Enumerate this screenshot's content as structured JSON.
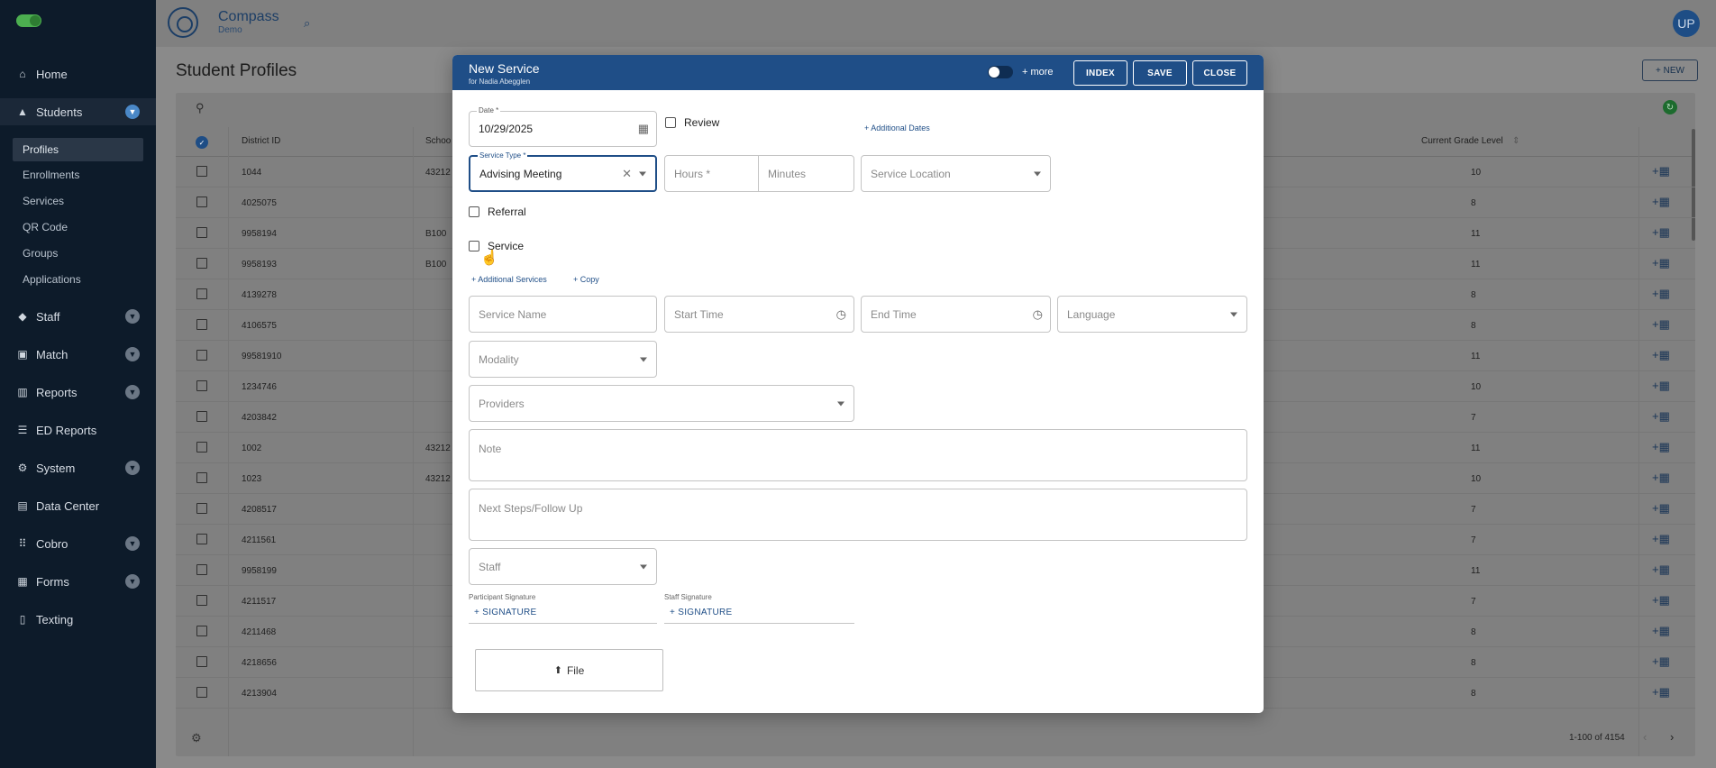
{
  "sidebar": {
    "items": [
      {
        "label": "Home",
        "icon": "home-icon"
      },
      {
        "label": "Students",
        "icon": "students-icon",
        "expanded": true
      },
      {
        "label": "Staff",
        "icon": "staff-icon"
      },
      {
        "label": "Match",
        "icon": "match-icon"
      },
      {
        "label": "Reports",
        "icon": "reports-icon"
      },
      {
        "label": "ED Reports",
        "icon": "ed-reports-icon"
      },
      {
        "label": "System",
        "icon": "gear-icon"
      },
      {
        "label": "Data Center",
        "icon": "data-center-icon"
      },
      {
        "label": "Cobro",
        "icon": "grid-icon"
      },
      {
        "label": "Forms",
        "icon": "forms-icon"
      },
      {
        "label": "Texting",
        "icon": "texting-icon"
      }
    ],
    "students_sub": [
      "Profiles",
      "Enrollments",
      "Services",
      "QR Code",
      "Groups",
      "Applications"
    ]
  },
  "header": {
    "brand": "Compass",
    "brand_sub": "Demo",
    "avatar": "UP"
  },
  "page": {
    "title": "Student Profiles",
    "new_button": "+ NEW"
  },
  "table": {
    "columns": [
      "District ID",
      "Schoo",
      "Current Grade Level"
    ],
    "rows": [
      {
        "id": "1044",
        "school": "43212",
        "grade": "10"
      },
      {
        "id": "4025075",
        "school": "",
        "grade": "8"
      },
      {
        "id": "9958194",
        "school": "B100",
        "grade": "11"
      },
      {
        "id": "9958193",
        "school": "B100",
        "grade": "11"
      },
      {
        "id": "4139278",
        "school": "",
        "grade": "8"
      },
      {
        "id": "4106575",
        "school": "",
        "grade": "8"
      },
      {
        "id": "99581910",
        "school": "",
        "grade": "11"
      },
      {
        "id": "1234746",
        "school": "",
        "grade": "10"
      },
      {
        "id": "4203842",
        "school": "",
        "grade": "7"
      },
      {
        "id": "1002",
        "school": "43212",
        "grade": "11"
      },
      {
        "id": "1023",
        "school": "43212",
        "grade": "10"
      },
      {
        "id": "4208517",
        "school": "",
        "grade": "7"
      },
      {
        "id": "4211561",
        "school": "",
        "grade": "7"
      },
      {
        "id": "9958199",
        "school": "",
        "grade": "11"
      },
      {
        "id": "4211517",
        "school": "",
        "grade": "7"
      },
      {
        "id": "4211468",
        "school": "",
        "grade": "8"
      },
      {
        "id": "4218656",
        "school": "",
        "grade": "8"
      },
      {
        "id": "4213904",
        "school": "",
        "grade": "8"
      }
    ],
    "pagination": "1-100 of 4154"
  },
  "modal": {
    "title": "New Service",
    "subtitle": "for Nadia Abegglen",
    "more_label": "+ more",
    "index_btn": "INDEX",
    "save_btn": "SAVE",
    "close_btn": "CLOSE",
    "date_label": "Date *",
    "date_value": "10/29/2025",
    "review_label": "Review",
    "additional_dates": "+ Additional Dates",
    "service_type_label": "Service Type *",
    "service_type_value": "Advising Meeting",
    "hours_ph": "Hours *",
    "minutes_ph": "Minutes",
    "service_location_ph": "Service Location",
    "referral_label": "Referral",
    "service_label": "Service",
    "additional_services": "+ Additional Services",
    "copy": "+ Copy",
    "service_name_ph": "Service Name",
    "start_time_ph": "Start Time",
    "end_time_ph": "End Time",
    "language_ph": "Language",
    "modality_ph": "Modality",
    "providers_ph": "Providers",
    "note_ph": "Note",
    "next_steps_ph": "Next Steps/Follow Up",
    "staff_ph": "Staff",
    "participant_sig_label": "Participant Signature",
    "staff_sig_label": "Staff Signature",
    "signature_btn": "+ SIGNATURE",
    "file_btn": "File"
  },
  "colors": {
    "sidebar_bg": "#0d1b2a",
    "modal_header": "#1f4e87",
    "overlay_bg": "#808080"
  }
}
